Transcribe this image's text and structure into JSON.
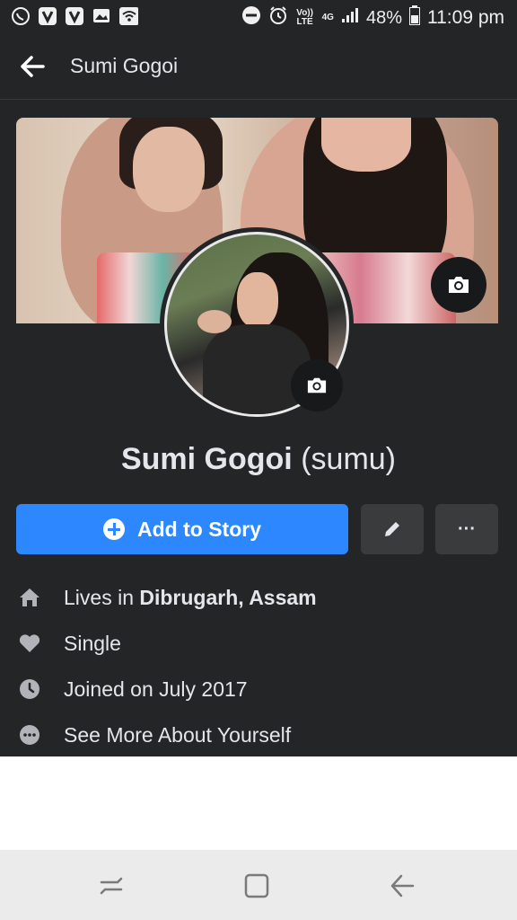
{
  "status_bar": {
    "left_icons": [
      "whatsapp-icon",
      "v-app-icon",
      "v-app-icon-2",
      "image-icon",
      "wifi-hotspot-icon"
    ],
    "volte": "Vo)) LTE",
    "network": "4G",
    "battery": "48%",
    "time": "11:09 pm"
  },
  "header": {
    "title": "Sumi Gogoi"
  },
  "profile": {
    "name": "Sumi Gogoi",
    "alt_name": "(sumu)"
  },
  "actions": {
    "add_story_label": "Add to Story",
    "more_label": "···"
  },
  "info": [
    {
      "icon": "home-icon",
      "prefix": "Lives in ",
      "bold": "Dibrugarh, Assam"
    },
    {
      "icon": "heart-icon",
      "prefix": "Single",
      "bold": ""
    },
    {
      "icon": "clock-icon",
      "prefix": "Joined on July 2017",
      "bold": ""
    },
    {
      "icon": "more-dots-icon",
      "prefix": "See More About Yourself",
      "bold": ""
    }
  ],
  "colors": {
    "background": "#242526",
    "accent": "#2d88ff",
    "secondary_button": "#3a3b3c"
  }
}
